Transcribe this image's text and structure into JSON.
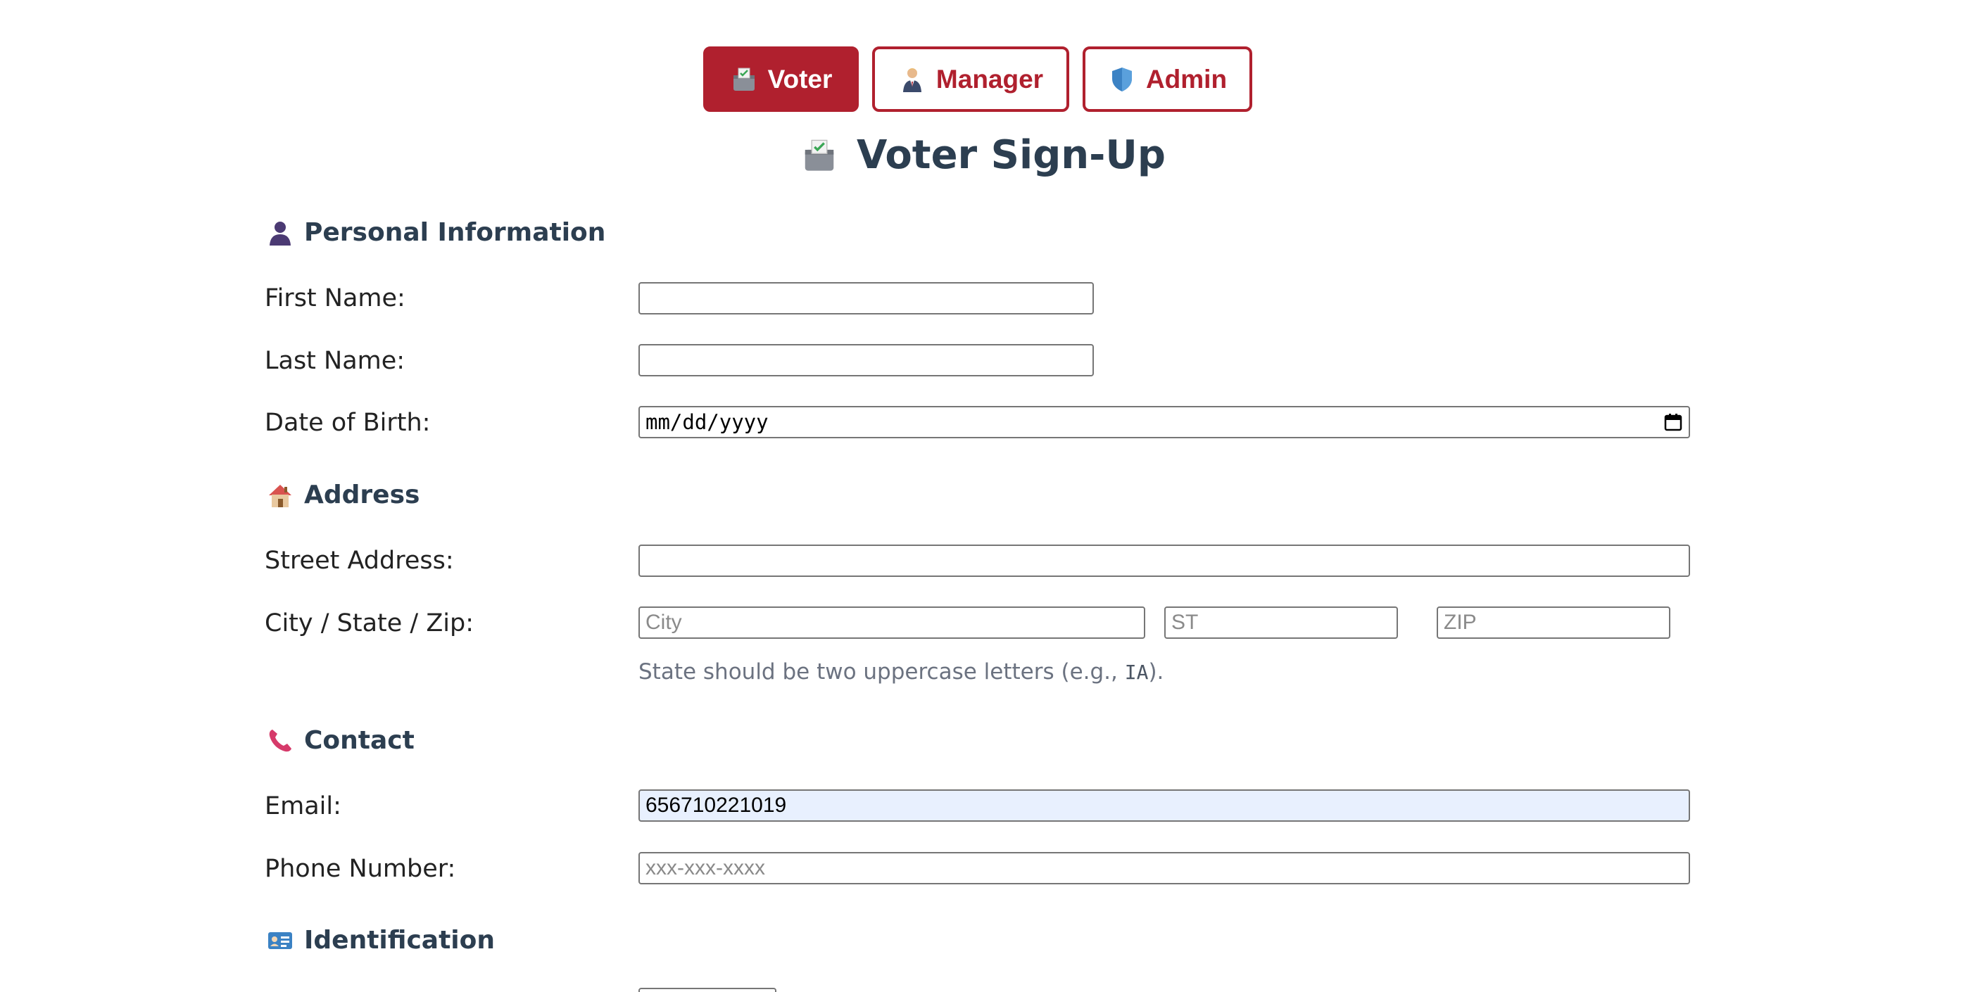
{
  "tabs": [
    {
      "label": "Voter",
      "icon": "ballot-box-icon",
      "active": true
    },
    {
      "label": "Manager",
      "icon": "manager-person-icon",
      "active": false
    },
    {
      "label": "Admin",
      "icon": "shield-icon",
      "active": false
    }
  ],
  "title": "Voter Sign-Up",
  "title_icon": "ballot-box-icon",
  "colors": {
    "accent": "#b0202e",
    "heading": "#2c3e50",
    "autofill_bg": "#e8f0fe",
    "hint": "#6b7280"
  },
  "sections": {
    "personal": {
      "heading": "Personal Information",
      "icon": "person-silhouette-icon",
      "first_name_label": "First Name:",
      "first_name_value": "",
      "last_name_label": "Last Name:",
      "last_name_value": "",
      "dob_label": "Date of Birth:",
      "dob_placeholder": "mm/dd/yyyy"
    },
    "address": {
      "heading": "Address",
      "icon": "house-icon",
      "street_label": "Street Address:",
      "street_value": "",
      "city_state_zip_label": "City / State / Zip:",
      "city_placeholder": "City",
      "state_placeholder": "ST",
      "zip_placeholder": "ZIP",
      "hint_prefix": "State should be two uppercase letters (e.g., ",
      "hint_code": "IA",
      "hint_suffix": ")."
    },
    "contact": {
      "heading": "Contact",
      "icon": "telephone-icon",
      "email_label": "Email:",
      "email_value": "656710221019",
      "phone_label": "Phone Number:",
      "phone_placeholder": "xxx-xxx-xxxx"
    },
    "identification": {
      "heading": "Identification",
      "icon": "id-card-icon"
    }
  }
}
